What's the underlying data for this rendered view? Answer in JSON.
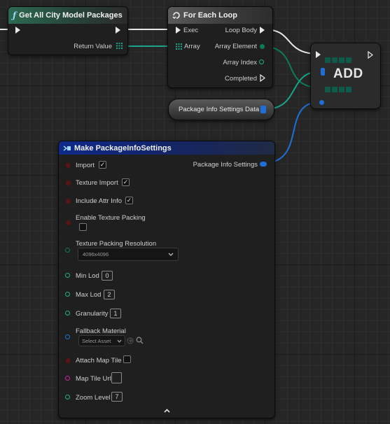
{
  "colors": {
    "exec": "#e8e8e8",
    "struct_pin": "#1f6fd6",
    "object_pin": "#18a58a",
    "bool_pin": "#8c1a1a",
    "string_pin": "#d020a8",
    "int_pin": "#1fb089",
    "enum_pin": "#0e7a5a"
  },
  "nodes": {
    "get_packages": {
      "title": "Get All City Model Packages",
      "icon": "function-icon",
      "output_label": "Return Value"
    },
    "for_each": {
      "title": "For Each Loop",
      "icon": "loop-icon",
      "exec_label": "Exec",
      "array_label": "Array",
      "loop_body_label": "Loop Body",
      "array_element_label": "Array Element",
      "array_index_label": "Array Index",
      "completed_label": "Completed"
    },
    "add": {
      "title": "ADD"
    },
    "settings_var": {
      "label": "Package Info Settings Data"
    },
    "make_settings": {
      "title": "Make PackageInfoSettings",
      "output_label": "Package Info Settings",
      "import_label": "Import",
      "import_checked": true,
      "texture_import_label": "Texture Import",
      "texture_import_checked": true,
      "include_attr_label": "Include Attr Info",
      "include_attr_checked": true,
      "enable_packing_label": "Enable Texture Packing",
      "enable_packing_checked": false,
      "resolution_label": "Texture Packing Resolution",
      "resolution_value": "4096x4096",
      "min_lod_label": "Min Lod",
      "min_lod_value": "0",
      "max_lod_label": "Max Lod",
      "max_lod_value": "2",
      "granularity_label": "Granularity",
      "granularity_value": "1",
      "fallback_label": "Fallback Material",
      "fallback_value": "Select Asset",
      "attach_map_label": "Attach Map Tile",
      "attach_map_checked": false,
      "map_tile_url_label": "Map Tile Url",
      "map_tile_url_value": "",
      "zoom_level_label": "Zoom Level",
      "zoom_level_value": "7",
      "collapse_icon": "chevron-up-icon"
    }
  }
}
